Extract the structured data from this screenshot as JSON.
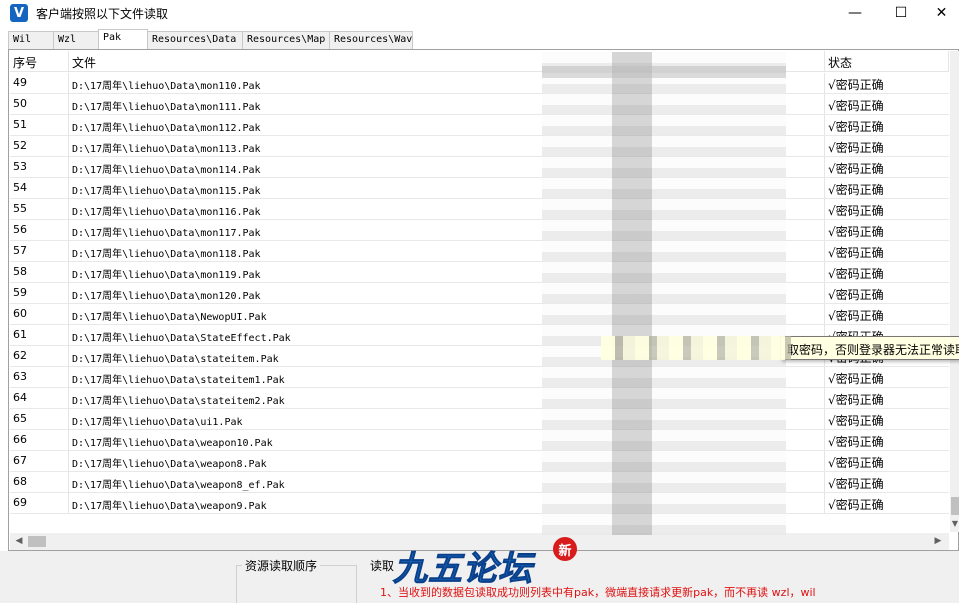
{
  "window": {
    "title": "客户端按照以下文件读取",
    "icon_letter": "V",
    "minimize_glyph": "—",
    "maximize_glyph": "☐",
    "close_glyph": "✕"
  },
  "tabs": [
    {
      "label": "Wil",
      "active": false
    },
    {
      "label": "Wzl",
      "active": false
    },
    {
      "label": "Pak",
      "active": true
    },
    {
      "label": "Resources\\Data",
      "active": false
    },
    {
      "label": "Resources\\Map",
      "active": false
    },
    {
      "label": "Resources\\Wav",
      "active": false
    }
  ],
  "table": {
    "columns": {
      "index": "序号",
      "file": "文件",
      "status": "状态"
    },
    "rows": [
      {
        "index": "49",
        "file": "D:\\17周年\\liehuo\\Data\\mon110.Pak",
        "status": "√密码正确"
      },
      {
        "index": "50",
        "file": "D:\\17周年\\liehuo\\Data\\mon111.Pak",
        "status": "√密码正确"
      },
      {
        "index": "51",
        "file": "D:\\17周年\\liehuo\\Data\\mon112.Pak",
        "status": "√密码正确"
      },
      {
        "index": "52",
        "file": "D:\\17周年\\liehuo\\Data\\mon113.Pak",
        "status": "√密码正确"
      },
      {
        "index": "53",
        "file": "D:\\17周年\\liehuo\\Data\\mon114.Pak",
        "status": "√密码正确"
      },
      {
        "index": "54",
        "file": "D:\\17周年\\liehuo\\Data\\mon115.Pak",
        "status": "√密码正确"
      },
      {
        "index": "55",
        "file": "D:\\17周年\\liehuo\\Data\\mon116.Pak",
        "status": "√密码正确"
      },
      {
        "index": "56",
        "file": "D:\\17周年\\liehuo\\Data\\mon117.Pak",
        "status": "√密码正确"
      },
      {
        "index": "57",
        "file": "D:\\17周年\\liehuo\\Data\\mon118.Pak",
        "status": "√密码正确"
      },
      {
        "index": "58",
        "file": "D:\\17周年\\liehuo\\Data\\mon119.Pak",
        "status": "√密码正确"
      },
      {
        "index": "59",
        "file": "D:\\17周年\\liehuo\\Data\\mon120.Pak",
        "status": "√密码正确"
      },
      {
        "index": "60",
        "file": "D:\\17周年\\liehuo\\Data\\NewopUI.Pak",
        "status": "√密码正确"
      },
      {
        "index": "61",
        "file": "D:\\17周年\\liehuo\\Data\\StateEffect.Pak",
        "status": "√密码正确"
      },
      {
        "index": "62",
        "file": "D:\\17周年\\liehuo\\Data\\stateitem.Pak",
        "status": "√密码正确"
      },
      {
        "index": "63",
        "file": "D:\\17周年\\liehuo\\Data\\stateitem1.Pak",
        "status": "√密码正确"
      },
      {
        "index": "64",
        "file": "D:\\17周年\\liehuo\\Data\\stateitem2.Pak",
        "status": "√密码正确"
      },
      {
        "index": "65",
        "file": "D:\\17周年\\liehuo\\Data\\ui1.Pak",
        "status": "√密码正确"
      },
      {
        "index": "66",
        "file": "D:\\17周年\\liehuo\\Data\\weapon10.Pak",
        "status": "√密码正确"
      },
      {
        "index": "67",
        "file": "D:\\17周年\\liehuo\\Data\\weapon8.Pak",
        "status": "√密码正确"
      },
      {
        "index": "68",
        "file": "D:\\17周年\\liehuo\\Data\\weapon8_ef.Pak",
        "status": "√密码正确"
      },
      {
        "index": "69",
        "file": "D:\\17周年\\liehuo\\Data\\weapon9.Pak",
        "status": "√密码正确"
      }
    ]
  },
  "tooltip": {
    "text": "取密码，否则登录器无法正常读取"
  },
  "bottom": {
    "group_order_label": "资源读取顺序",
    "group2_label": "读取",
    "note": "1、当收到的数据包读取成功则列表中有pak，微端直接请求更新pak，而不再读 wzl，wil"
  },
  "watermark": {
    "text": "九五论坛",
    "badge": "新"
  },
  "colors": {
    "note_red": "#e01010",
    "logo_blue": "#1f7bd8",
    "tooltip_bg": "#ffffe1"
  }
}
